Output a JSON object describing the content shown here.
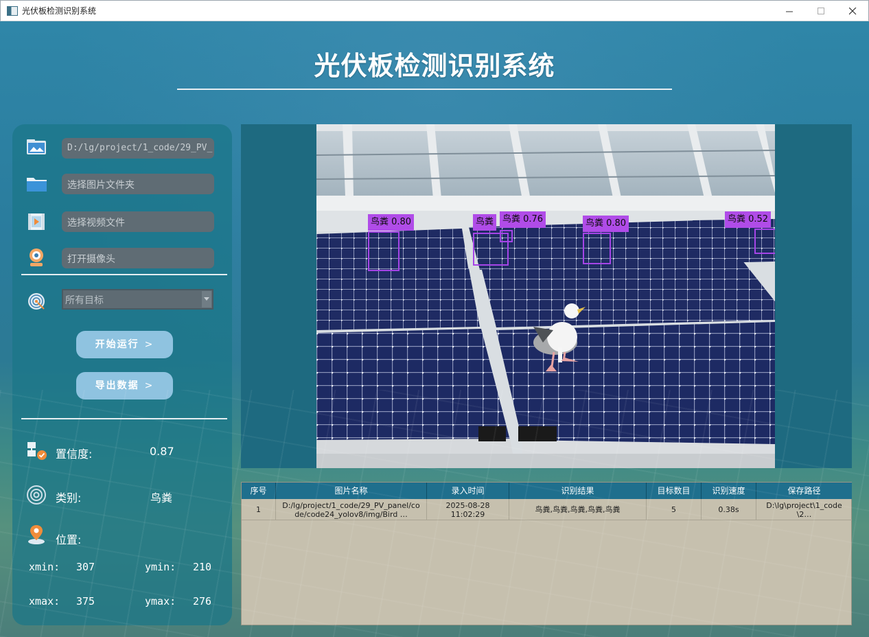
{
  "window": {
    "title": "光伏板检测识别系统"
  },
  "app_title": "光伏板检测识别系统",
  "inputs": {
    "image_path": "D:/lg/project/1_code/29_PV_",
    "folder_placeholder": "选择图片文件夹",
    "video_placeholder": "选择视频文件",
    "camera_placeholder": "打开摄像头"
  },
  "target_select": {
    "selected": "所有目标"
  },
  "buttons": {
    "start": "开始运行",
    "export": "导出数据",
    "chevron": ">"
  },
  "info": {
    "confidence_label": "置信度:",
    "confidence_value": "0.87",
    "class_label": "类别:",
    "class_value": "鸟粪",
    "position_label": "位置:",
    "xmin_label": "xmin:",
    "xmin_value": "307",
    "ymin_label": "ymin:",
    "ymin_value": "210",
    "xmax_label": "xmax:",
    "xmax_value": "375",
    "ymax_label": "ymax:",
    "ymax_value": "276"
  },
  "detections": [
    {
      "label": "鸟粪 0.80"
    },
    {
      "label": "鸟粪"
    },
    {
      "label": "鸟粪 0.76"
    },
    {
      "label": "鸟粪 0.80"
    },
    {
      "label": "鸟粪 0.52"
    }
  ],
  "table": {
    "headers": [
      "序号",
      "图片名称",
      "录入时间",
      "识别结果",
      "目标数目",
      "识别速度",
      "保存路径"
    ],
    "rows": [
      {
        "index": "1",
        "name": "D:/lg/project/1_code/29_PV_panel/code/code24_yolov8/img/Bird …",
        "time": "2025-08-28 11:02:29",
        "result": "鸟粪,鸟粪,鸟粪,鸟粪,鸟粪",
        "count": "5",
        "speed": "0.38s",
        "save_path": "D:\\lg\\project\\1_code\\2…"
      }
    ]
  },
  "colors": {
    "accent": "#8fc3e0",
    "detection": "#b04ce8",
    "table_header": "#1f6f8d",
    "table_body": "#c6c0ae"
  }
}
